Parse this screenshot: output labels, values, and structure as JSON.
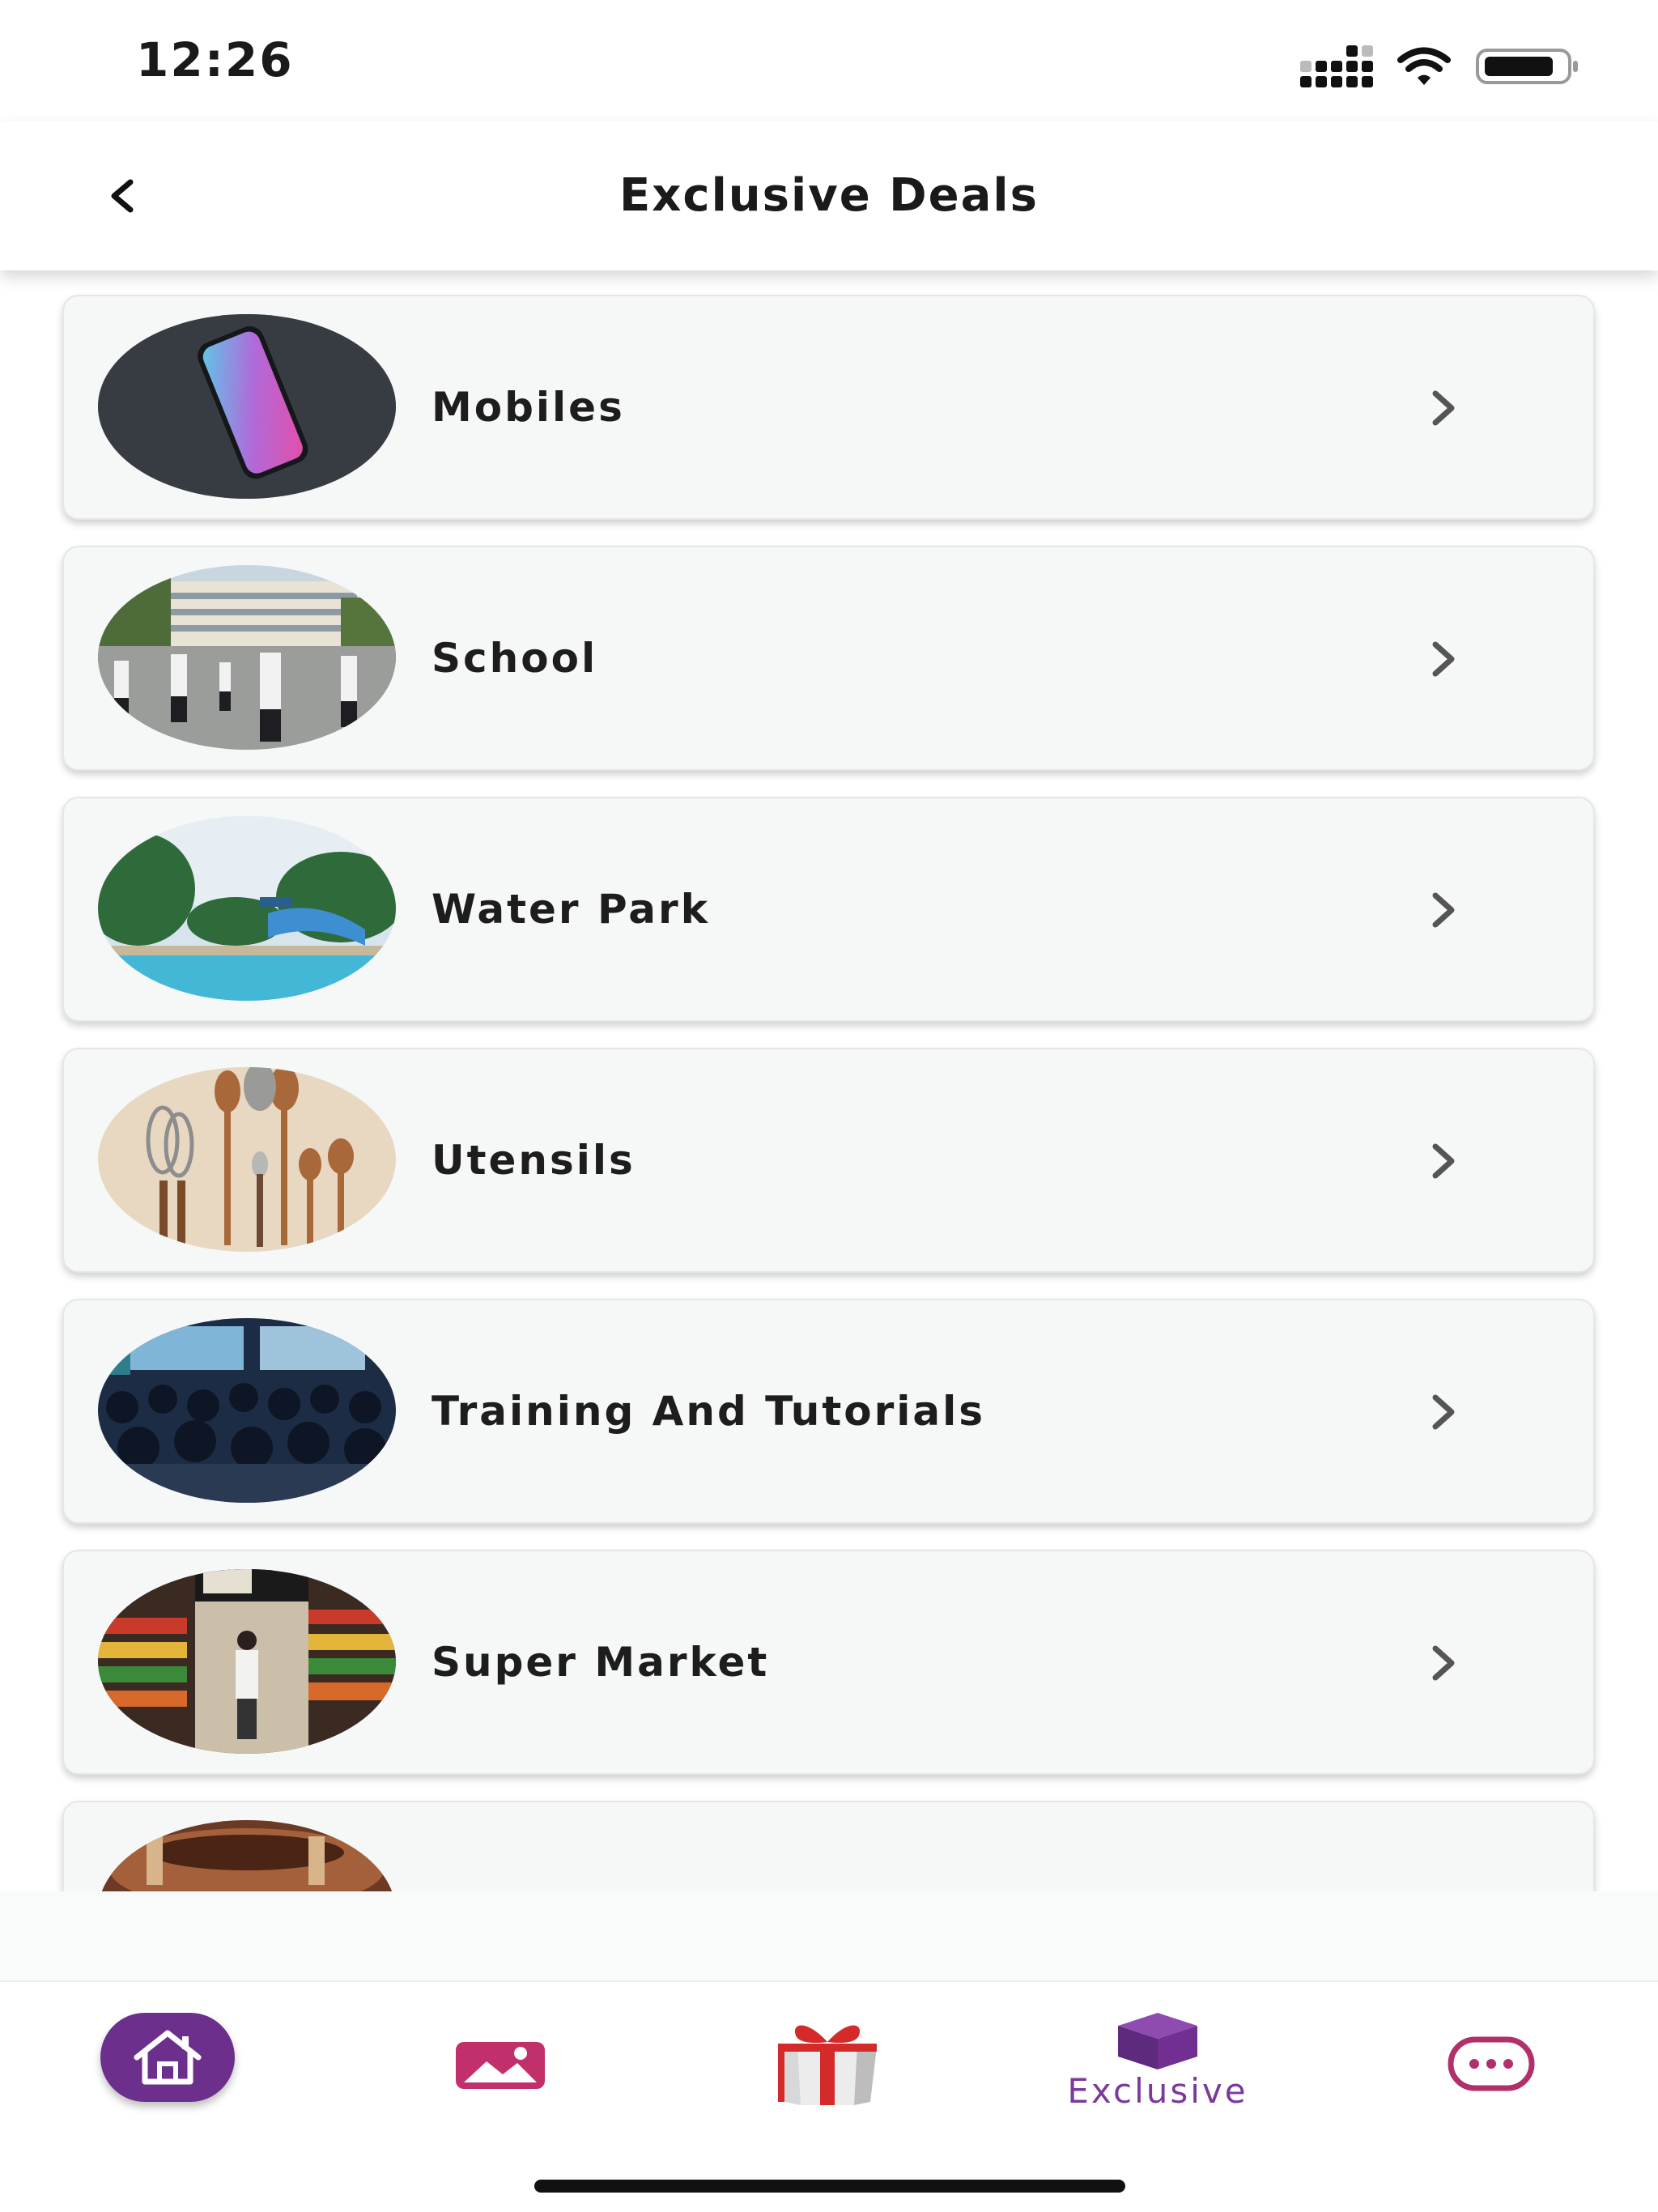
{
  "status_bar": {
    "time": "12:26"
  },
  "header": {
    "title": "Exclusive Deals"
  },
  "deals": [
    {
      "label": "Mobiles",
      "image": "phone-photo"
    },
    {
      "label": "School",
      "image": "school-photo"
    },
    {
      "label": "Water Park",
      "image": "water-park-photo"
    },
    {
      "label": "Utensils",
      "image": "utensils-photo"
    },
    {
      "label": "Training And Tutorials",
      "image": "training-photo"
    },
    {
      "label": "Super Market",
      "image": "supermarket-photo"
    }
  ],
  "bottom_nav": {
    "exclusive_label": "Exclusive",
    "items": [
      "home-icon",
      "gallery-icon",
      "gift-icon",
      "exclusive-box-icon",
      "more-icon"
    ]
  },
  "colors": {
    "accent_purple": "#6d2f8c",
    "nav_pink": "#b0306a",
    "gift_red": "#d42a2a"
  }
}
